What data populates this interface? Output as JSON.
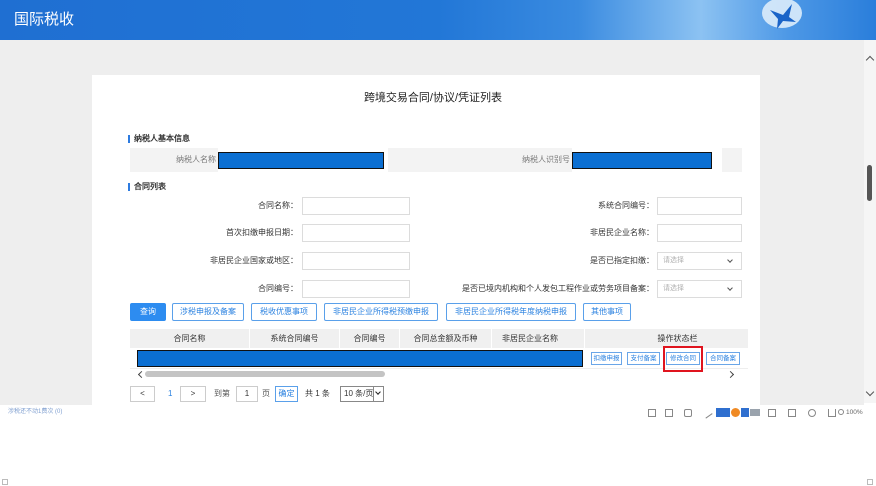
{
  "header": {
    "title": "国际税收",
    "logo_icon": "bird-logo-icon"
  },
  "page": {
    "title": "跨境交易合同/协议/凭证列表"
  },
  "taxpayer": {
    "heading": "纳税人基本信息",
    "name_label": "纳税人名称",
    "id_label": "纳税人识别号"
  },
  "contracts": {
    "heading": "合同列表"
  },
  "filters": {
    "contract_name": {
      "label": "合同名称：",
      "value": ""
    },
    "first_declare_date": {
      "label": "首次扣缴申报日期：",
      "value": ""
    },
    "country_region": {
      "label": "非居民企业国家或地区：",
      "value": ""
    },
    "contract_no": {
      "label": "合同编号：",
      "value": ""
    },
    "system_contract_no": {
      "label": "系统合同编号：",
      "value": ""
    },
    "enterprise_name": {
      "label": "非居民企业名称：",
      "value": ""
    },
    "designated_withholding": {
      "label": "是否已指定扣缴：",
      "placeholder": "请选择"
    },
    "project_filing": {
      "label": "是否已境内机构和个人发包工程作业或劳务项目备案：",
      "placeholder": "请选择"
    }
  },
  "toolbar": {
    "query": "查询",
    "tax_filing": "涉税申报及备案",
    "tax_incentives": "税收优惠事项",
    "prepay_declare": "非居民企业所得税预缴申报",
    "annual_declare": "非居民企业所得税年度纳税申报",
    "other": "其他事项"
  },
  "table": {
    "columns": [
      "合同名称",
      "系统合同编号",
      "合同编号",
      "合同总金额及币种",
      "非居民企业名称",
      "操作状态栏"
    ],
    "rows": [
      {
        "actions": [
          "扣缴申报",
          "支付备案",
          "修改合同",
          "合同备案"
        ]
      }
    ]
  },
  "pagination": {
    "prev": "<",
    "current": "1",
    "next": ">",
    "goto_label": "到第",
    "goto_value": "1",
    "page_suffix": "页",
    "confirm": "确定",
    "total": "共 1 条",
    "page_size": "10 条/页"
  },
  "status_bar": {
    "left_text": "涉税还不动1费次 (0)",
    "zoom": "100%"
  },
  "colors": {
    "header": "#2277d7",
    "primary": "#2d8cf0",
    "highlight_box": "#e0141e",
    "redaction": "#0b6fd2",
    "page_background": "#eeeeee"
  }
}
